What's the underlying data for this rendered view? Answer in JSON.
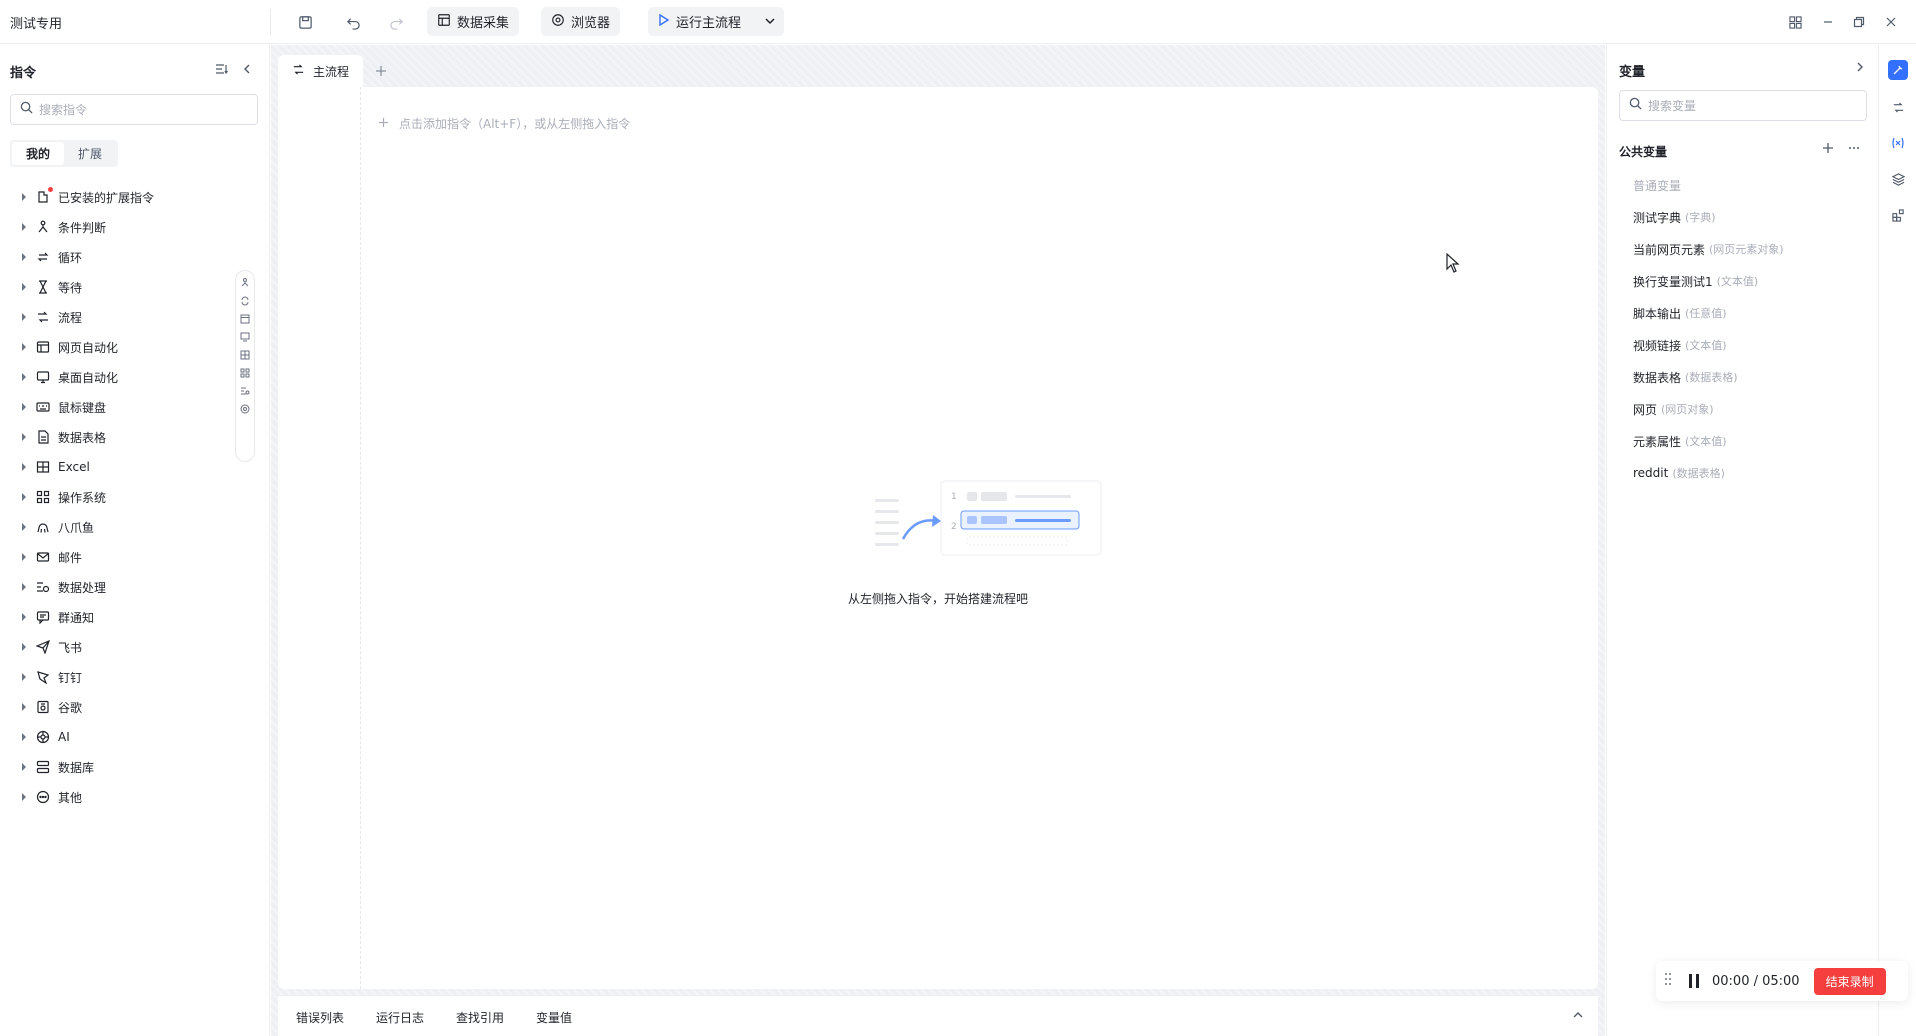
{
  "app": {
    "title": "测试专用"
  },
  "toolbar": {
    "data_capture": "数据采集",
    "browser": "浏览器",
    "run_main": "运行主流程"
  },
  "left": {
    "title": "指令",
    "search_placeholder": "搜索指令",
    "segments": [
      "我的",
      "扩展"
    ],
    "items": [
      {
        "label": "已安装的扩展指令",
        "icon": "puzzle-icon"
      },
      {
        "label": "条件判断",
        "icon": "branch-icon"
      },
      {
        "label": "循环",
        "icon": "loop-icon"
      },
      {
        "label": "等待",
        "icon": "hourglass-icon"
      },
      {
        "label": "流程",
        "icon": "flow-icon"
      },
      {
        "label": "网页自动化",
        "icon": "web-icon"
      },
      {
        "label": "桌面自动化",
        "icon": "desktop-icon"
      },
      {
        "label": "鼠标键盘",
        "icon": "keyboard-icon"
      },
      {
        "label": "数据表格",
        "icon": "document-icon"
      },
      {
        "label": "Excel",
        "icon": "excel-icon"
      },
      {
        "label": "操作系统",
        "icon": "grid-icon"
      },
      {
        "label": "八爪鱼",
        "icon": "octopus-icon"
      },
      {
        "label": "邮件",
        "icon": "mail-icon"
      },
      {
        "label": "数据处理",
        "icon": "data-process-icon"
      },
      {
        "label": "群通知",
        "icon": "chat-icon"
      },
      {
        "label": "飞书",
        "icon": "send-icon"
      },
      {
        "label": "钉钉",
        "icon": "dingtalk-icon"
      },
      {
        "label": "谷歌",
        "icon": "google-icon"
      },
      {
        "label": "AI",
        "icon": "ai-icon"
      },
      {
        "label": "数据库",
        "icon": "database-icon"
      },
      {
        "label": "其他",
        "icon": "more-circle-icon"
      }
    ]
  },
  "center": {
    "tab_label": "主流程",
    "add_hint": "点击添加指令（Alt+F），或从左侧拖入指令",
    "empty_text": "从左侧拖入指令，开始搭建流程吧",
    "illus_rows": [
      "1",
      "2"
    ],
    "bottom_tabs": [
      "错误列表",
      "运行日志",
      "查找引用",
      "变量值"
    ]
  },
  "right": {
    "title": "变量",
    "search_placeholder": "搜索变量",
    "section": "公共变量",
    "group_label": "普通变量",
    "variables": [
      {
        "name": "测试字典",
        "type": "(字典)"
      },
      {
        "name": "当前网页元素",
        "type": "(网页元素对象)"
      },
      {
        "name": "换行变量测试1",
        "type": "(文本值)"
      },
      {
        "name": "脚本输出",
        "type": "(任意值)"
      },
      {
        "name": "视频链接",
        "type": "(文本值)"
      },
      {
        "name": "数据表格",
        "type": "(数据表格)"
      },
      {
        "name": "网页",
        "type": "(网页对象)"
      },
      {
        "name": "元素属性",
        "type": "(文本值)"
      },
      {
        "name": "reddit",
        "type": "(数据表格)"
      }
    ]
  },
  "recorder": {
    "time": "00:00 / 05:00",
    "stop_label": "结束录制"
  },
  "colors": {
    "accent": "#3370ff",
    "danger": "#f53f3f"
  }
}
